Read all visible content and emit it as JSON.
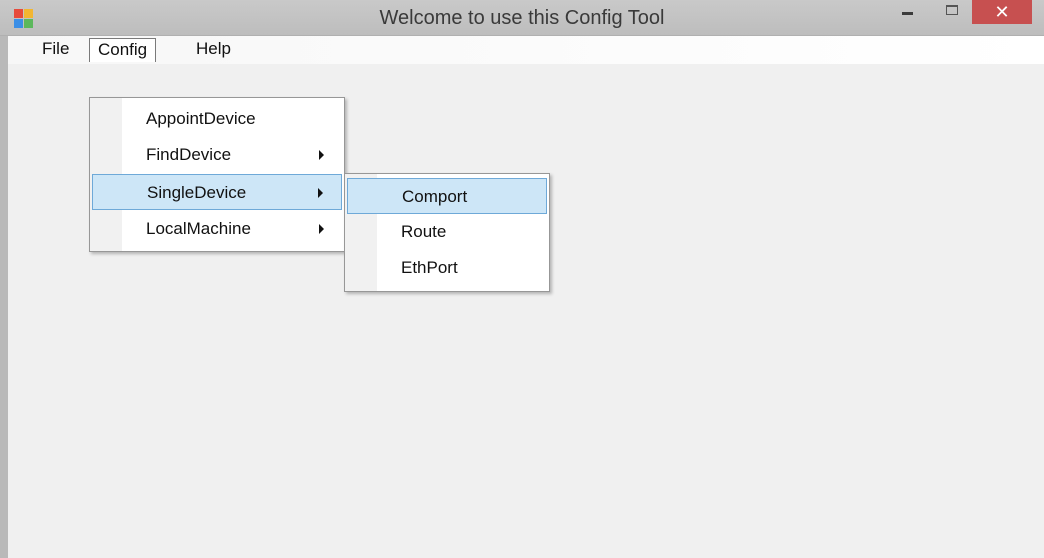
{
  "window": {
    "title": "Welcome  to use this Config Tool",
    "close_glyph": "✕",
    "icons": [
      "app-icon",
      "minimize-icon",
      "maximize-icon",
      "close-icon"
    ]
  },
  "menubar": {
    "items": [
      {
        "label": "File"
      },
      {
        "label": "Config",
        "open": true
      },
      {
        "label": "Help"
      }
    ]
  },
  "config_menu": {
    "items": [
      {
        "label": "AppointDevice",
        "has_submenu": false
      },
      {
        "label": "FindDevice",
        "has_submenu": true
      },
      {
        "label": "SingleDevice",
        "has_submenu": true,
        "highlighted": true
      },
      {
        "label": "LocalMachine",
        "has_submenu": true
      }
    ]
  },
  "singledevice_submenu": {
    "items": [
      {
        "label": "Comport",
        "highlighted": true
      },
      {
        "label": "Route"
      },
      {
        "label": "EthPort"
      }
    ]
  },
  "colors": {
    "titlebar": "#c4c4c4",
    "close_button": "#c75050",
    "highlight_fill": "#cde6f7",
    "highlight_border": "#6ea9d8",
    "client_background": "#f0f0f0"
  }
}
